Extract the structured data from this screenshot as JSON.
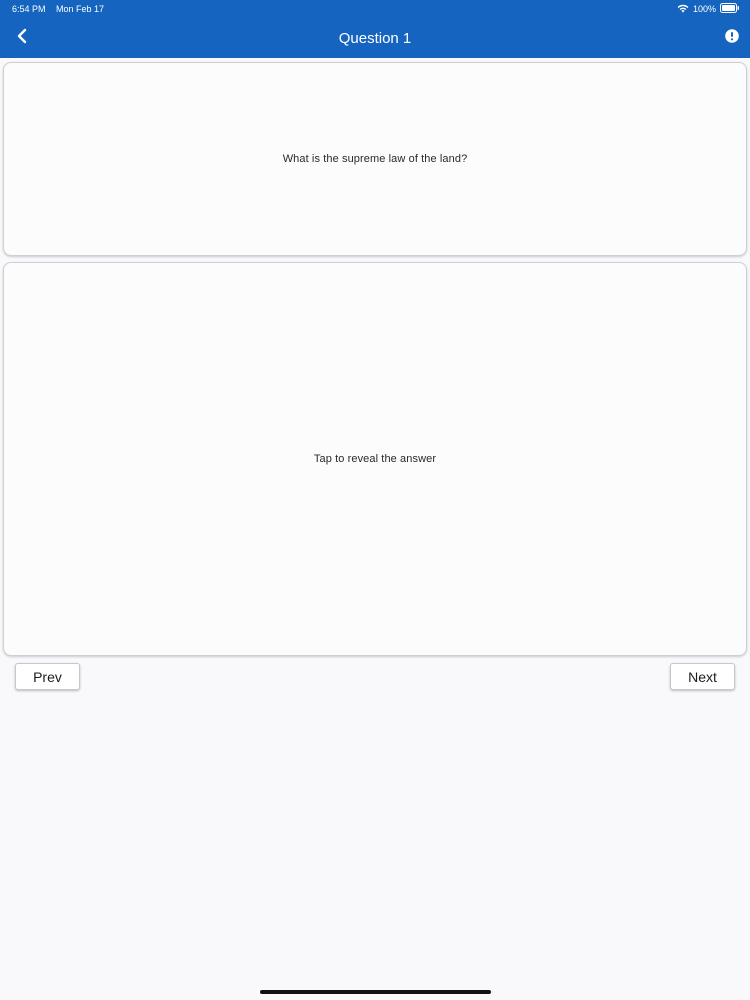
{
  "status_bar": {
    "time": "6:54 PM",
    "date": "Mon Feb 17",
    "battery": "100%",
    "wifi_icon": "wifi-icon",
    "battery_icon": "battery-icon"
  },
  "header": {
    "title": "Question 1",
    "back_icon": "chevron-left-icon",
    "info_icon": "exclamation-circle-icon",
    "background_color": "#1565c0"
  },
  "question_card": {
    "text": "What is the supreme law of the land?"
  },
  "answer_card": {
    "text": "Tap to reveal the answer"
  },
  "navigation": {
    "prev_label": "Prev",
    "next_label": "Next"
  }
}
